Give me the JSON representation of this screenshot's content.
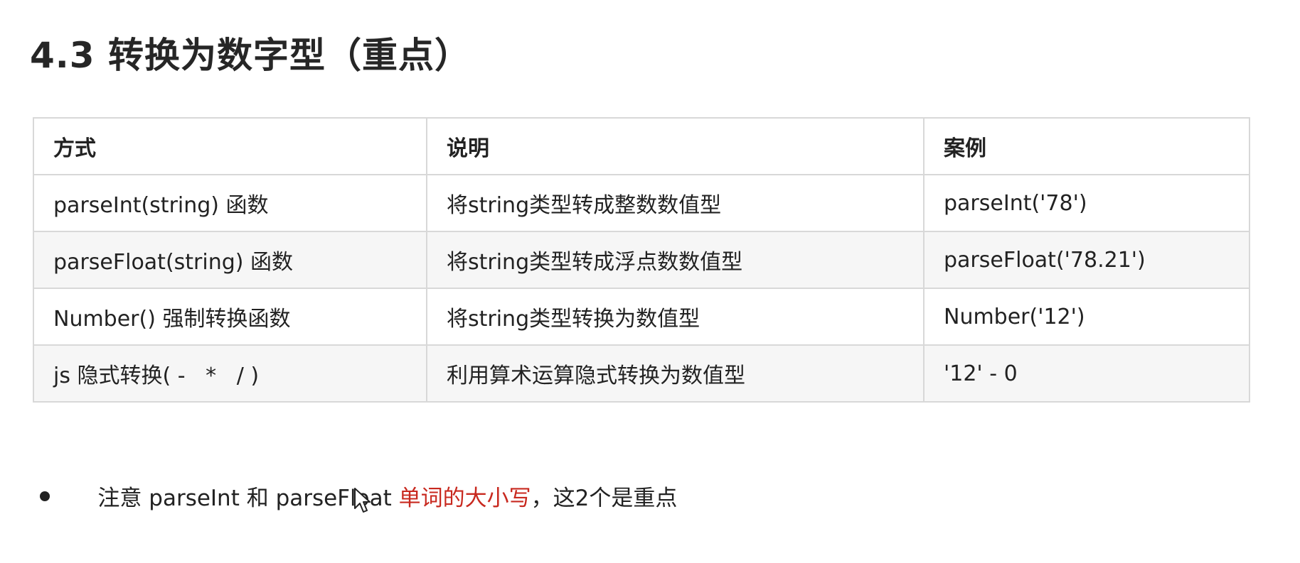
{
  "title": "4.3 转换为数字型（重点）",
  "table": {
    "headers": [
      "方式",
      "说明",
      "案例"
    ],
    "rows": [
      [
        "parseInt(string) 函数",
        "将string类型转成整数数值型",
        "parseInt('78')"
      ],
      [
        "parseFloat(string) 函数",
        "将string类型转成浮点数数值型",
        "parseFloat('78.21')"
      ],
      [
        "Number() 强制转换函数",
        "将string类型转换为数值型",
        "Number('12')"
      ],
      [
        "js 隐式转换( -   *   / )",
        "利用算术运算隐式转换为数值型",
        "'12' - 0"
      ]
    ]
  },
  "note": {
    "part1": "注意 parseInt 和 parseFloat ",
    "highlight": "单词的大小写",
    "part2": "，这2个是重点",
    "highlight_color": "#c8291f"
  },
  "icons": {
    "bullet": "bullet-dot-icon",
    "cursor": "mouse-pointer-icon"
  }
}
